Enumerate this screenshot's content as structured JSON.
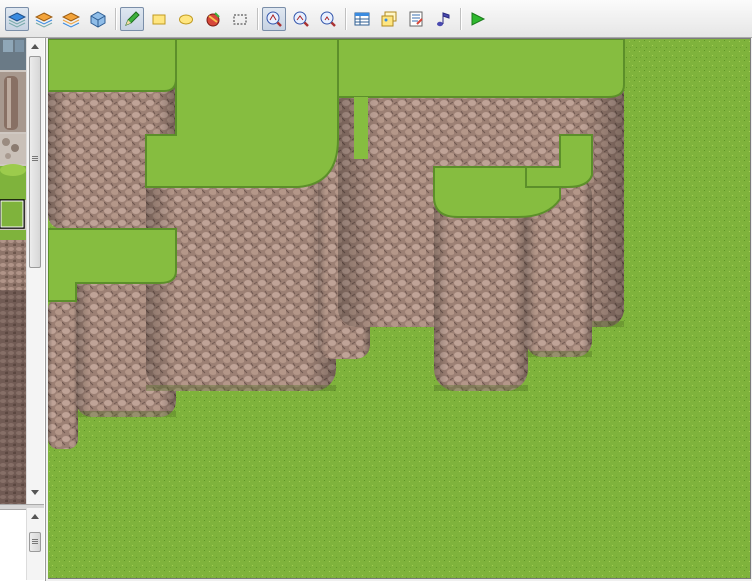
{
  "window": {
    "width": 752,
    "height": 581
  },
  "toolbar": {
    "groups": [
      [
        {
          "name": "layer-1-icon",
          "active": true
        },
        {
          "name": "layer-2-icon",
          "active": false
        },
        {
          "name": "layer-3-icon",
          "active": false
        },
        {
          "name": "event-layer-icon",
          "active": false
        }
      ],
      [
        {
          "name": "pencil-icon",
          "active": true
        },
        {
          "name": "rectangle-icon",
          "active": false
        },
        {
          "name": "ellipse-icon",
          "active": false
        },
        {
          "name": "fill-icon",
          "active": false
        },
        {
          "name": "select-icon",
          "active": false
        }
      ],
      [
        {
          "name": "zoom-1-1-icon",
          "active": true
        },
        {
          "name": "zoom-1-2-icon",
          "active": false
        },
        {
          "name": "zoom-1-4-icon",
          "active": false
        }
      ],
      [
        {
          "name": "database-icon",
          "active": false
        },
        {
          "name": "materials-icon",
          "active": false
        },
        {
          "name": "script-editor-icon",
          "active": false
        },
        {
          "name": "sound-test-icon",
          "active": false
        }
      ],
      [
        {
          "name": "playtest-icon",
          "active": false
        }
      ]
    ]
  },
  "colors": {
    "grass": "#7fb33c",
    "grass_dark": "#5f9628",
    "grass_light": "#9ccb4c",
    "rock": "#9c8074",
    "rock_light": "#c8aca0",
    "rock_dark": "#5f4a42",
    "accent_active": "#7a8ea8"
  }
}
